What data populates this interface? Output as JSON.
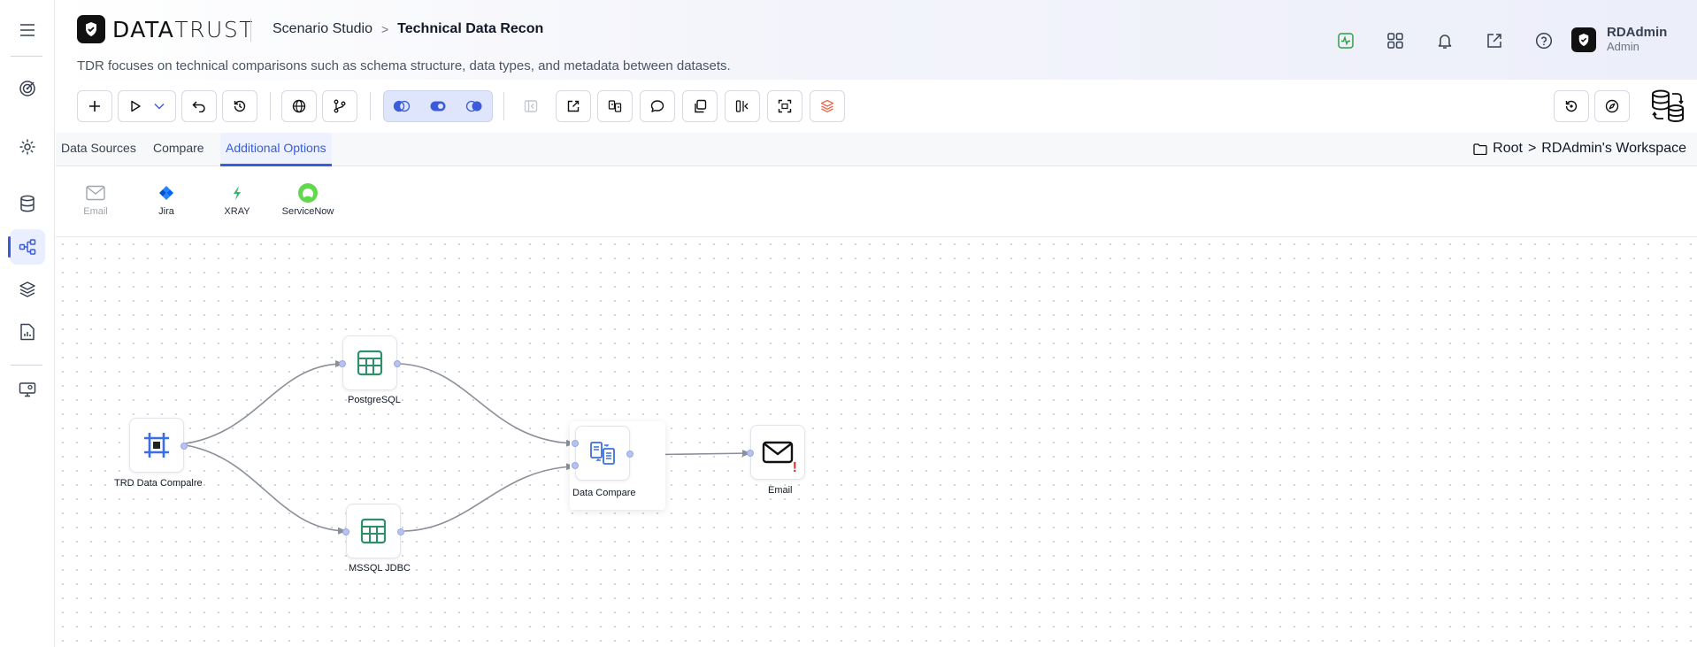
{
  "app": {
    "brand_bold": "DATA",
    "brand_light": "TRUST"
  },
  "header": {
    "breadcrumb_parent": "Scenario Studio",
    "breadcrumb_separator": ">",
    "breadcrumb_current": "Technical Data Recon",
    "subtitle": "TDR focuses on technical comparisons such as schema structure, data types, and metadata between datasets.",
    "icons": [
      "activity-icon",
      "apps-grid-icon",
      "bell-icon",
      "external-link-icon",
      "help-icon"
    ],
    "user": {
      "name": "RDAdmin",
      "role": "Admin"
    }
  },
  "tabs": {
    "items": [
      "Data Sources",
      "Compare",
      "Additional Options"
    ],
    "active": "Additional Options"
  },
  "workspace": {
    "root": "Root",
    "separator": ">",
    "name": "RDAdmin's Workspace"
  },
  "palette": {
    "items": [
      {
        "label": "Email",
        "enabled": false,
        "icon": "mail-icon"
      },
      {
        "label": "Jira",
        "enabled": true,
        "icon": "jira-icon"
      },
      {
        "label": "XRAY",
        "enabled": true,
        "icon": "xray-icon"
      },
      {
        "label": "ServiceNow",
        "enabled": true,
        "icon": "servicenow-icon"
      }
    ]
  },
  "nodes": {
    "trd": {
      "label": "TRD Data Compalre"
    },
    "postgres": {
      "label": "PostgreSQL"
    },
    "mssql": {
      "label": "MSSQL JDBC"
    },
    "compare": {
      "label": "Data Compare"
    },
    "email": {
      "label": "Email",
      "warning": "!"
    }
  },
  "colors": {
    "accent": "#3b5bdb",
    "table_green": "#2f8f6a",
    "node_blue": "#3b6fe0",
    "warning_red": "#e03131",
    "servicenow_green": "#62d84e"
  }
}
